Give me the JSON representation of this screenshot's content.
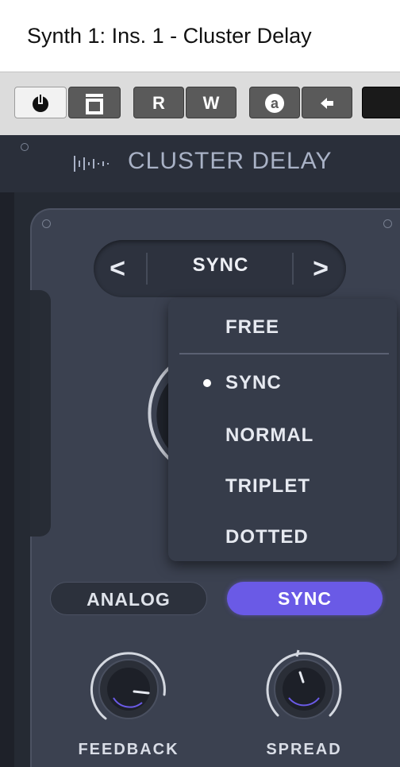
{
  "window": {
    "title": "Synth 1: Ins. 1 - Cluster Delay"
  },
  "toolbar": {
    "buttons": [
      {
        "name": "power-button",
        "icon": "power-icon"
      },
      {
        "name": "bypass-button",
        "icon": "bypass-icon"
      },
      {
        "name": "read-automation-button",
        "label": "R"
      },
      {
        "name": "write-automation-button",
        "label": "W"
      },
      {
        "name": "auto-button",
        "icon": "a-circle-icon"
      },
      {
        "name": "arrow-button",
        "icon": "arrow-left-icon"
      }
    ]
  },
  "plugin": {
    "name": "CLUSTER DELAY",
    "logo_icon": "waveform-icon"
  },
  "mode_selector": {
    "prev_label": "<",
    "next_label": ">",
    "value": "SYNC"
  },
  "dropdown": {
    "top_option": "FREE",
    "options": [
      {
        "label": "SYNC",
        "selected": true
      },
      {
        "label": "NORMAL",
        "selected": false
      },
      {
        "label": "TRIPLET",
        "selected": false
      },
      {
        "label": "DOTTED",
        "selected": false
      }
    ]
  },
  "mode_buttons": {
    "analog_label": "ANALOG",
    "sync_label": "SYNC",
    "active": "SYNC"
  },
  "knobs": {
    "feedback_label": "FEEDBACK",
    "spread_label": "SPREAD"
  },
  "colors": {
    "accent": "#6a5ae6",
    "panel": "#3b4150",
    "text": "#e6e9f0"
  }
}
